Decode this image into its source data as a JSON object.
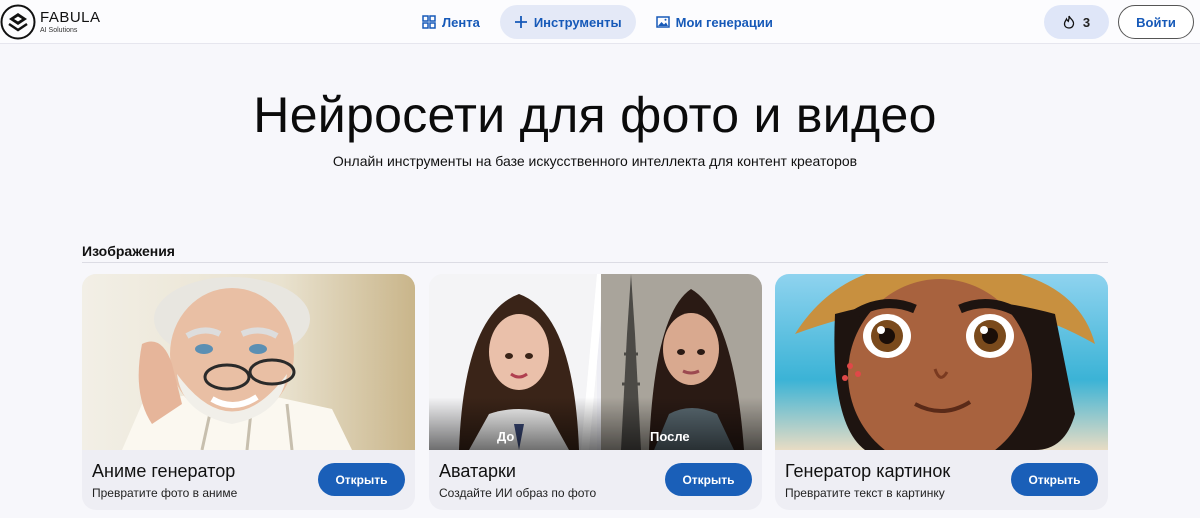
{
  "brand": {
    "name": "FABULA",
    "tagline": "AI Solutions"
  },
  "nav": [
    {
      "label": "Лента",
      "icon": "grid-icon"
    },
    {
      "label": "Инструменты",
      "icon": "plus-icon",
      "active": true
    },
    {
      "label": "Мои генерации",
      "icon": "image-icon"
    }
  ],
  "credits": {
    "value": "3",
    "icon": "flame-icon"
  },
  "login_label": "Войти",
  "hero": {
    "title": "Нейросети для фото и видео",
    "subtitle": "Онлайн инструменты на базе искусственного интеллекта для контент креаторов"
  },
  "section": {
    "title": "Изображения"
  },
  "cards": [
    {
      "title": "Аниме генератор",
      "desc": "Превратите фото в аниме",
      "button": "Открыть"
    },
    {
      "title": "Аватарки",
      "desc": "Создайте ИИ образ по фото",
      "button": "Открыть",
      "before_label": "До",
      "after_label": "После"
    },
    {
      "title": "Генератор картинок",
      "desc": "Превратите текст в картинку",
      "button": "Открыть"
    }
  ],
  "colors": {
    "accent": "#1a5fb8",
    "nav_text": "#1659b8",
    "active_bg": "#e4e9f7"
  }
}
